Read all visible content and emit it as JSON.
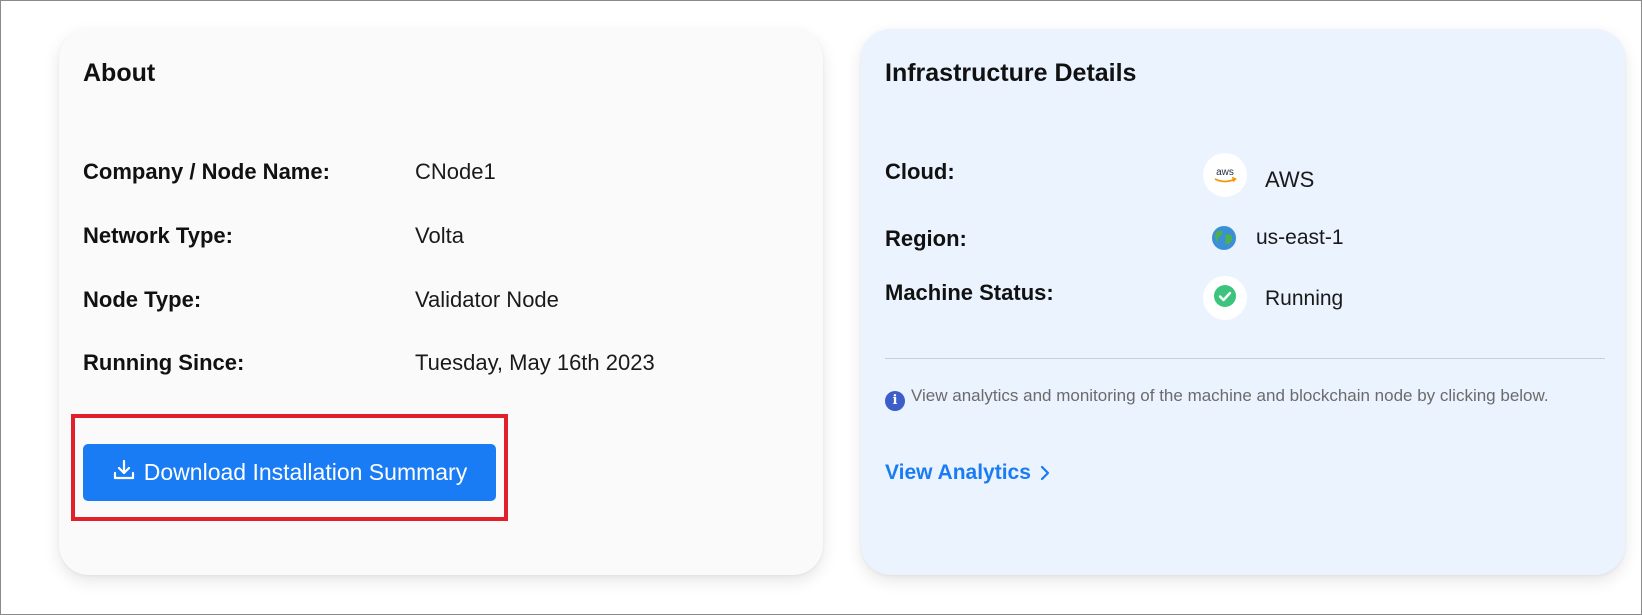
{
  "about": {
    "title": "About",
    "rows": [
      {
        "label": "Company / Node Name:",
        "value": "CNode1"
      },
      {
        "label": "Network Type:",
        "value": "Volta"
      },
      {
        "label": "Node Type:",
        "value": "Validator Node"
      },
      {
        "label": "Running Since:",
        "value": "Tuesday, May 16th 2023"
      }
    ],
    "download_label": "Download Installation Summary"
  },
  "infra": {
    "title": "Infrastructure Details",
    "cloud": {
      "label": "Cloud:",
      "value": "AWS",
      "icon": "aws-logo-icon",
      "logo_text": "aws"
    },
    "region": {
      "label": "Region:",
      "value": "us-east-1",
      "icon": "globe-icon"
    },
    "status": {
      "label": "Machine Status:",
      "value": "Running",
      "icon": "check-circle-icon",
      "color": "#3cc47c"
    },
    "info_text": "View analytics and monitoring of the machine and blockchain node by clicking below.",
    "info_icon_glyph": "i",
    "link_label": "View Analytics"
  },
  "colors": {
    "accent": "#1a7cf5",
    "highlight": "#e0202b"
  }
}
